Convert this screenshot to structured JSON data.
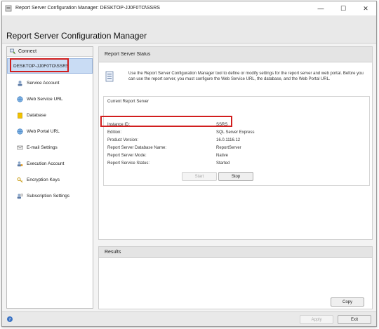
{
  "window": {
    "title": "Report Server Configuration Manager: DESKTOP-JJ0F0TO\\SSRS",
    "minimize_glyph": "—",
    "maximize_glyph": "☐",
    "close_glyph": "✕"
  },
  "app": {
    "title": "Report Server Configuration Manager"
  },
  "sidebar": {
    "connect_label": "Connect",
    "server_label": "DESKTOP-JJ0F0TO\\SSRS",
    "items": [
      {
        "label": "Service Account",
        "icon": "service-account-icon"
      },
      {
        "label": "Web Service URL",
        "icon": "globe-icon"
      },
      {
        "label": "Database",
        "icon": "database-icon"
      },
      {
        "label": "Web Portal URL",
        "icon": "globe-icon"
      },
      {
        "label": "E-mail Settings",
        "icon": "email-icon"
      },
      {
        "label": "Execution Account",
        "icon": "execution-account-icon"
      },
      {
        "label": "Encryption Keys",
        "icon": "key-icon"
      },
      {
        "label": "Subscription Settings",
        "icon": "subscription-icon"
      }
    ]
  },
  "status": {
    "header": "Report Server Status",
    "intro": "Use the Report Server Configuration Manager tool to define or modify settings for the report server and web portal. Before you can use the report server, you must configure the Web Service URL, the database, and the Web Portal URL.",
    "current_title": "Current Report Server",
    "rows": [
      {
        "label": "Instance ID:",
        "value": "SSRS"
      },
      {
        "label": "Edition:",
        "value": "SQL Server Express"
      },
      {
        "label": "Product Version:",
        "value": "16.0.1116.12"
      },
      {
        "label": "Report Server Database Name:",
        "value": "ReportServer"
      },
      {
        "label": "Report Server Mode:",
        "value": "Native"
      },
      {
        "label": "Report Service Status:",
        "value": "Started"
      }
    ],
    "start_label": "Start",
    "stop_label": "Stop"
  },
  "results": {
    "header": "Results",
    "copy_label": "Copy"
  },
  "footer": {
    "apply_label": "Apply",
    "exit_label": "Exit"
  },
  "colors": {
    "highlight": "#d11e1e",
    "selection": "#c9dcf4"
  }
}
